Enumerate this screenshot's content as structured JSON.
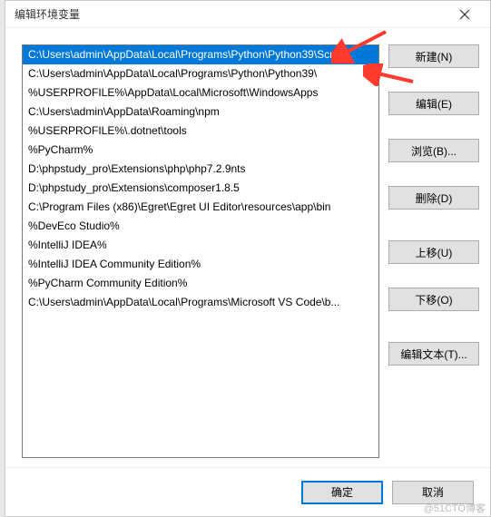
{
  "dialog": {
    "title": "编辑环境变量"
  },
  "list": {
    "items": [
      "C:\\Users\\admin\\AppData\\Local\\Programs\\Python\\Python39\\Scri...",
      "C:\\Users\\admin\\AppData\\Local\\Programs\\Python\\Python39\\",
      "%USERPROFILE%\\AppData\\Local\\Microsoft\\WindowsApps",
      "C:\\Users\\admin\\AppData\\Roaming\\npm",
      "%USERPROFILE%\\.dotnet\\tools",
      "%PyCharm%",
      "D:\\phpstudy_pro\\Extensions\\php\\php7.2.9nts",
      "D:\\phpstudy_pro\\Extensions\\composer1.8.5",
      "C:\\Program Files (x86)\\Egret\\Egret UI Editor\\resources\\app\\bin",
      "%DevEco Studio%",
      "%IntelliJ IDEA%",
      "%IntelliJ IDEA Community Edition%",
      "%PyCharm Community Edition%",
      "C:\\Users\\admin\\AppData\\Local\\Programs\\Microsoft VS Code\\b..."
    ],
    "selected_index": 0
  },
  "buttons": {
    "new": "新建(N)",
    "edit": "编辑(E)",
    "browse": "浏览(B)...",
    "delete": "删除(D)",
    "move_up": "上移(U)",
    "move_down": "下移(O)",
    "edit_text": "编辑文本(T)..."
  },
  "footer": {
    "ok": "确定",
    "cancel": "取消"
  },
  "watermark": "@51CTO博客",
  "colors": {
    "selection": "#0078d7",
    "arrow": "#ff3b30"
  }
}
